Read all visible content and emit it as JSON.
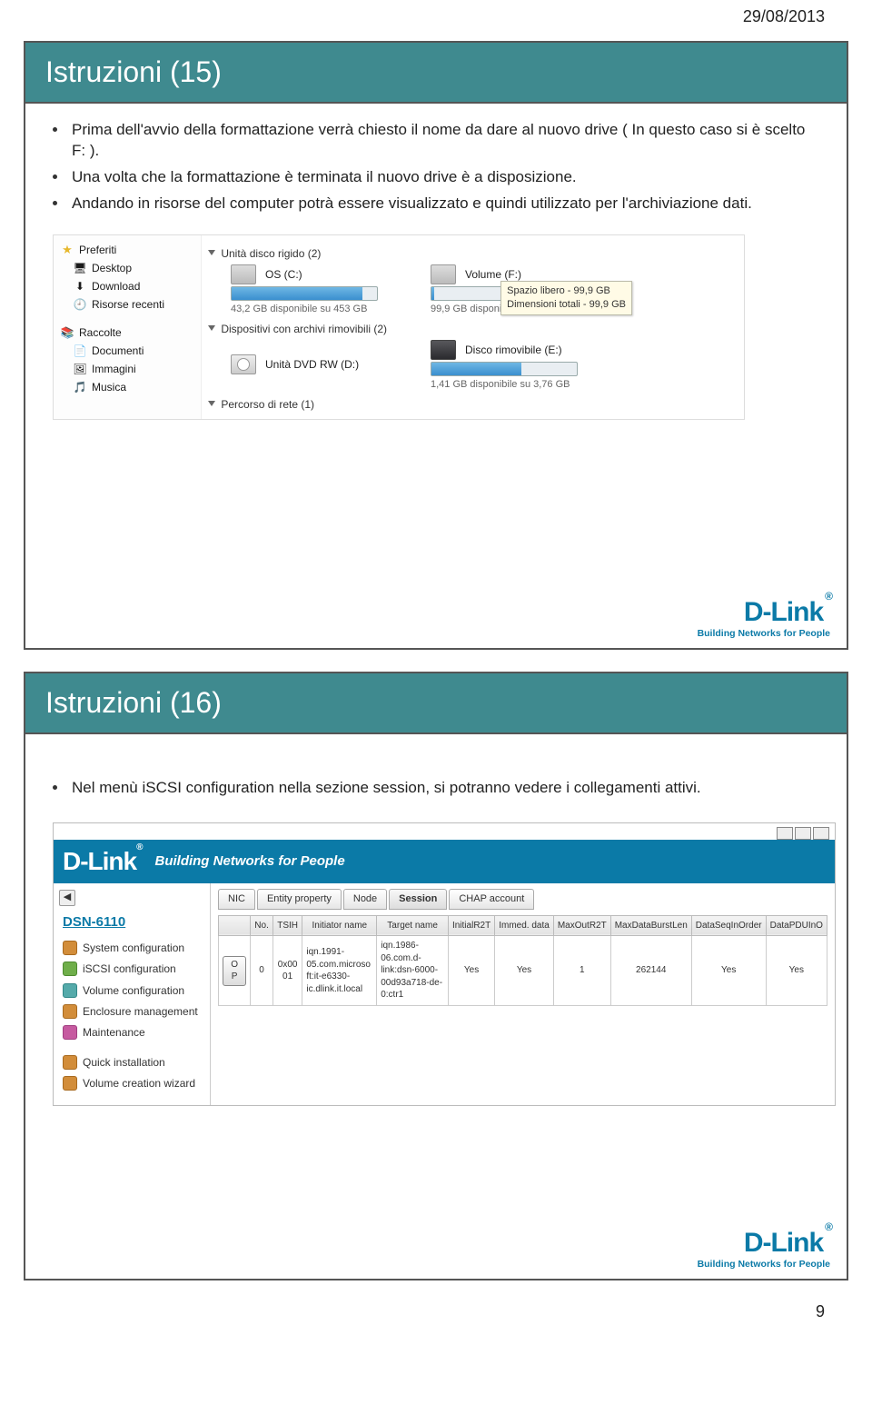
{
  "date": "29/08/2013",
  "pageNumber": "9",
  "dlink": {
    "brand": "D-Link",
    "tag": "Building Networks for People"
  },
  "slide15": {
    "title": "Istruzioni (15)",
    "bullets": [
      "Prima dell'avvio della formattazione verrà chiesto il nome da dare al nuovo drive ( In questo caso si è scelto F: ).",
      "Una volta che la formattazione è terminata il nuovo drive è a disposizione.",
      "Andando in risorse del computer potrà essere visualizzato e quindi utilizzato per l'archiviazione dati."
    ],
    "explorer": {
      "side": {
        "fav": "Preferiti",
        "favItems": [
          "Desktop",
          "Download",
          "Risorse recenti"
        ],
        "lib": "Raccolte",
        "libItems": [
          "Documenti",
          "Immagini",
          "Musica"
        ]
      },
      "cat1": "Unità disco rigido (2)",
      "cat2": "Dispositivi con archivi rimovibili (2)",
      "cat3": "Percorso di rete (1)",
      "os": {
        "name": "OS (C:)",
        "sub": "43,2 GB disponibile su 453 GB"
      },
      "vol": {
        "name": "Volume (F:)",
        "sub": "99,9 GB disponibili"
      },
      "tooltip": {
        "l1": "Spazio libero - 99,9 GB",
        "l2": "Dimensioni totali - 99,9 GB"
      },
      "dvd": {
        "name": "Unità DVD RW (D:)"
      },
      "rem": {
        "name": "Disco rimovibile (E:)",
        "sub": "1,41 GB disponibile su 3,76 GB"
      }
    }
  },
  "slide16": {
    "title": "Istruzioni (16)",
    "bullet": "Nel menù iSCSI configuration nella sezione session, si potranno vedere i collegamenti attivi.",
    "admin": {
      "model": "DSN-6110",
      "menu": [
        "System configuration",
        "iSCSI configuration",
        "Volume configuration",
        "Enclosure management",
        "Maintenance"
      ],
      "menu2": [
        "Quick installation",
        "Volume creation wizard"
      ],
      "tabs": [
        "NIC",
        "Entity property",
        "Node",
        "Session",
        "CHAP account"
      ],
      "cols": [
        "",
        "No.",
        "TSIH",
        "Initiator name",
        "Target name",
        "InitialR2T",
        "Immed. data",
        "MaxOutR2T",
        "MaxDataBurstLen",
        "DataSeqInOrder",
        "DataPDUInO"
      ],
      "row": {
        "op": "OP",
        "no": "0",
        "tsih": "0x0001",
        "init": "iqn.1991-05.com.microsoft:it-e6330-ic.dlink.it.local",
        "tgt": "iqn.1986-06.com.d-link:dsn-6000-00d93a718-de-0:ctr1",
        "r2t": "Yes",
        "immed": "Yes",
        "maxout": "1",
        "burst": "262144",
        "seq": "Yes",
        "pdu": "Yes"
      }
    }
  }
}
